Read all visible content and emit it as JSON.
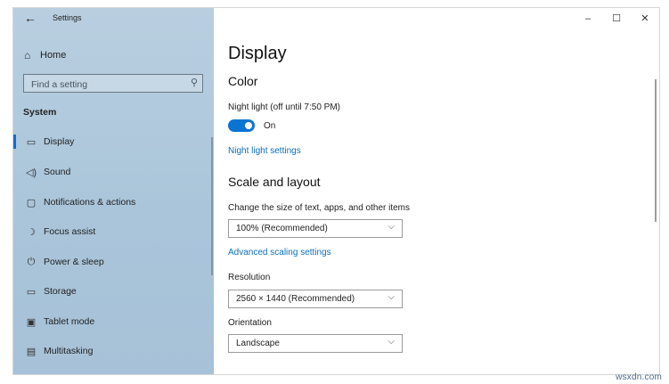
{
  "window": {
    "title": "Settings",
    "minimize": "–",
    "maximize": "☐",
    "close": "✕"
  },
  "sidebar": {
    "back_icon": "←",
    "home": {
      "icon": "⌂",
      "label": "Home"
    },
    "search_placeholder": "Find a setting",
    "search_icon": "⚲",
    "section": "System",
    "items": [
      {
        "icon": "▭",
        "label": "Display",
        "selected": true
      },
      {
        "icon": "◁)",
        "label": "Sound"
      },
      {
        "icon": "▢",
        "label": "Notifications & actions"
      },
      {
        "icon": "☽",
        "label": "Focus assist"
      },
      {
        "icon": "⏻",
        "label": "Power & sleep"
      },
      {
        "icon": "▭",
        "label": "Storage"
      },
      {
        "icon": "▣",
        "label": "Tablet mode"
      },
      {
        "icon": "▤",
        "label": "Multitasking"
      }
    ]
  },
  "main": {
    "title": "Display",
    "color_heading": "Color",
    "night_light_label": "Night light (off until 7:50 PM)",
    "night_light_state": "On",
    "night_light_link": "Night light settings",
    "scale_heading": "Scale and layout",
    "scale_label": "Change the size of text, apps, and other items",
    "scale_value": "100% (Recommended)",
    "advanced_link": "Advanced scaling settings",
    "resolution_label": "Resolution",
    "resolution_value": "2560 × 1440 (Recommended)",
    "orientation_label": "Orientation",
    "orientation_value": "Landscape",
    "chevron": "⌵"
  },
  "watermark": "wsxdn.com",
  "colors": {
    "accent": "#0a74d2",
    "sidebar": "#b0c8dc",
    "link": "#0b6ebd"
  }
}
